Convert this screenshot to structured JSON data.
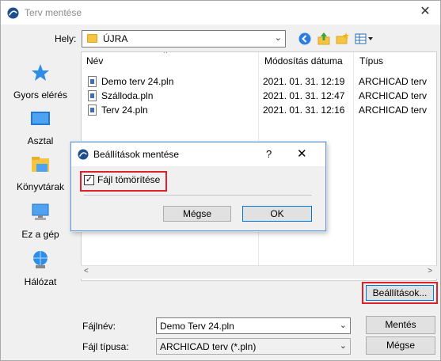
{
  "window": {
    "title": "Terv mentése",
    "close_glyph": "✕"
  },
  "toolbar": {
    "lookin_label": "Hely:",
    "lookin_value": "ÚJRA",
    "icons": [
      "back-icon",
      "up-folder-icon",
      "new-folder-icon",
      "view-menu-icon"
    ]
  },
  "places": [
    {
      "label": "Gyors elérés",
      "icon": "star-icon"
    },
    {
      "label": "Asztal",
      "icon": "desktop-icon"
    },
    {
      "label": "Könyvtárak",
      "icon": "libraries-icon"
    },
    {
      "label": "Ez a gép",
      "icon": "computer-icon"
    },
    {
      "label": "Hálózat",
      "icon": "network-icon"
    }
  ],
  "filelist": {
    "columns": [
      "Név",
      "Módosítás dátuma",
      "Típus"
    ],
    "rows": [
      {
        "name": "Demo terv 24.pln",
        "date": "2021. 01. 31. 12:19",
        "type": "ARCHICAD terv"
      },
      {
        "name": "Szálloda.pln",
        "date": "2021. 01. 31. 12:47",
        "type": "ARCHICAD terv"
      },
      {
        "name": "Terv 24.pln",
        "date": "2021. 01. 31. 12:16",
        "type": "ARCHICAD terv"
      }
    ]
  },
  "buttons": {
    "settings": "Beállítások...",
    "save": "Mentés",
    "cancel": "Mégse"
  },
  "fields": {
    "filename_label": "Fájlnév:",
    "filename_value": "Demo Terv 24.pln",
    "filetype_label": "Fájl típusa:",
    "filetype_value": "ARCHICAD terv (*.pln)"
  },
  "dialog": {
    "title": "Beállítások mentése",
    "help_glyph": "?",
    "close_glyph": "✕",
    "checkbox_label": "Fájl tömörítése",
    "checkbox_checked": true,
    "cancel": "Mégse",
    "ok": "OK"
  },
  "colors": {
    "accent": "#0078d7",
    "highlight_box": "#e0202b"
  }
}
